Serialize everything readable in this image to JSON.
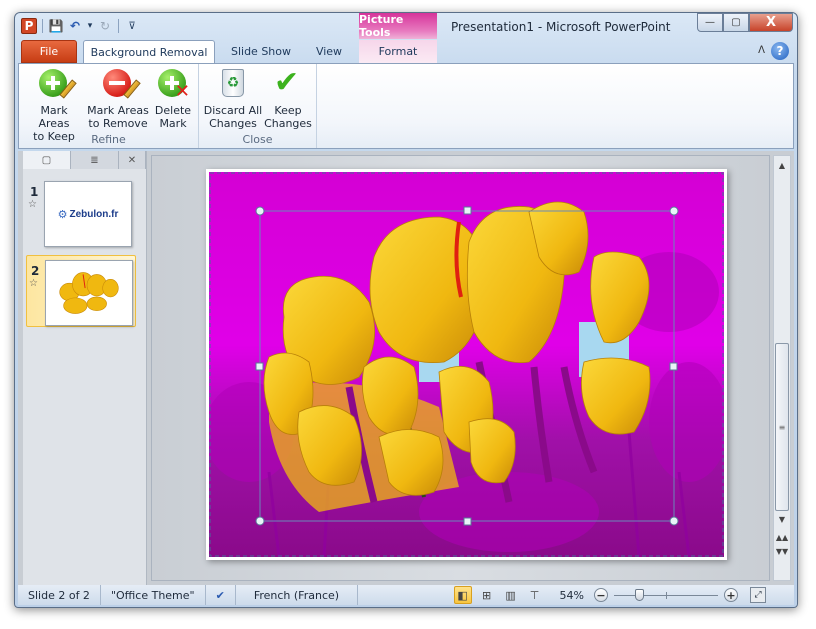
{
  "window": {
    "title": "Presentation1  -  Microsoft PowerPoint",
    "context_tab_group": "Picture Tools",
    "app_icon_letter": "P",
    "controls": {
      "minimize": "—",
      "maximize": "▢",
      "close": "X"
    }
  },
  "quick_access": {
    "items": [
      {
        "name": "save-icon",
        "glyph": "💾"
      },
      {
        "name": "undo-icon",
        "glyph": "↶"
      },
      {
        "name": "undo-dropdown-icon",
        "glyph": "▾"
      },
      {
        "name": "redo-icon",
        "glyph": "↻"
      },
      {
        "name": "customize-qat-icon",
        "glyph": "⊽"
      }
    ]
  },
  "tabs": {
    "file": "File",
    "background_removal": "Background Removal",
    "slide_show": "Slide Show",
    "view": "View",
    "format": "Format",
    "minimize_ribbon_glyph": "ᐱ",
    "help_glyph": "?"
  },
  "ribbon": {
    "groups": [
      {
        "label": "Refine",
        "buttons": [
          {
            "line1": "Mark Areas",
            "line2": "to Keep",
            "icon": "mark-keep-icon"
          },
          {
            "line1": "Mark Areas",
            "line2": "to Remove",
            "icon": "mark-remove-icon"
          },
          {
            "line1": "Delete",
            "line2": "Mark",
            "icon": "delete-mark-icon"
          }
        ]
      },
      {
        "label": "Close",
        "buttons": [
          {
            "line1": "Discard All",
            "line2": "Changes",
            "icon": "recycle-bin-icon"
          },
          {
            "line1": "Keep",
            "line2": "Changes",
            "icon": "checkmark-icon"
          }
        ]
      }
    ]
  },
  "slides_pane": {
    "tabs": {
      "slides_glyph": "▢",
      "outline_glyph": "≣",
      "close_glyph": "✕"
    },
    "slides": [
      {
        "number": "1",
        "transition_glyph": "☆",
        "content": "Zebulon.fr",
        "logo_glyph": "⚙"
      },
      {
        "number": "2",
        "transition_glyph": "☆",
        "content": "tulips",
        "selected": true
      }
    ]
  },
  "scrollbar": {
    "up": "▲",
    "down": "▼",
    "grip": "≡",
    "prev_slide": "▲▲",
    "next_slide": "▼▼"
  },
  "status_bar": {
    "slide_info": "Slide 2 of 2",
    "theme": "\"Office Theme\"",
    "language": "French (France)",
    "zoom": "54%",
    "zoom_level_fraction": 0.54,
    "views": [
      {
        "name": "normal-view-icon",
        "glyph": "◧",
        "active": true
      },
      {
        "name": "slide-sorter-icon",
        "glyph": "⊞"
      },
      {
        "name": "reading-view-icon",
        "glyph": "▥"
      },
      {
        "name": "slideshow-view-icon",
        "glyph": "⊤"
      }
    ],
    "zoom_out": "−",
    "zoom_in": "+",
    "fit_glyph": "⤢"
  },
  "colors": {
    "removal_magenta": "#d800d8",
    "removal_dark": "#8a0a8a",
    "tulip_yellow": "#f2c012",
    "tulip_shadow": "#c88a08",
    "sky": "#a8d8f0",
    "selection_line": "#6a88b8"
  }
}
